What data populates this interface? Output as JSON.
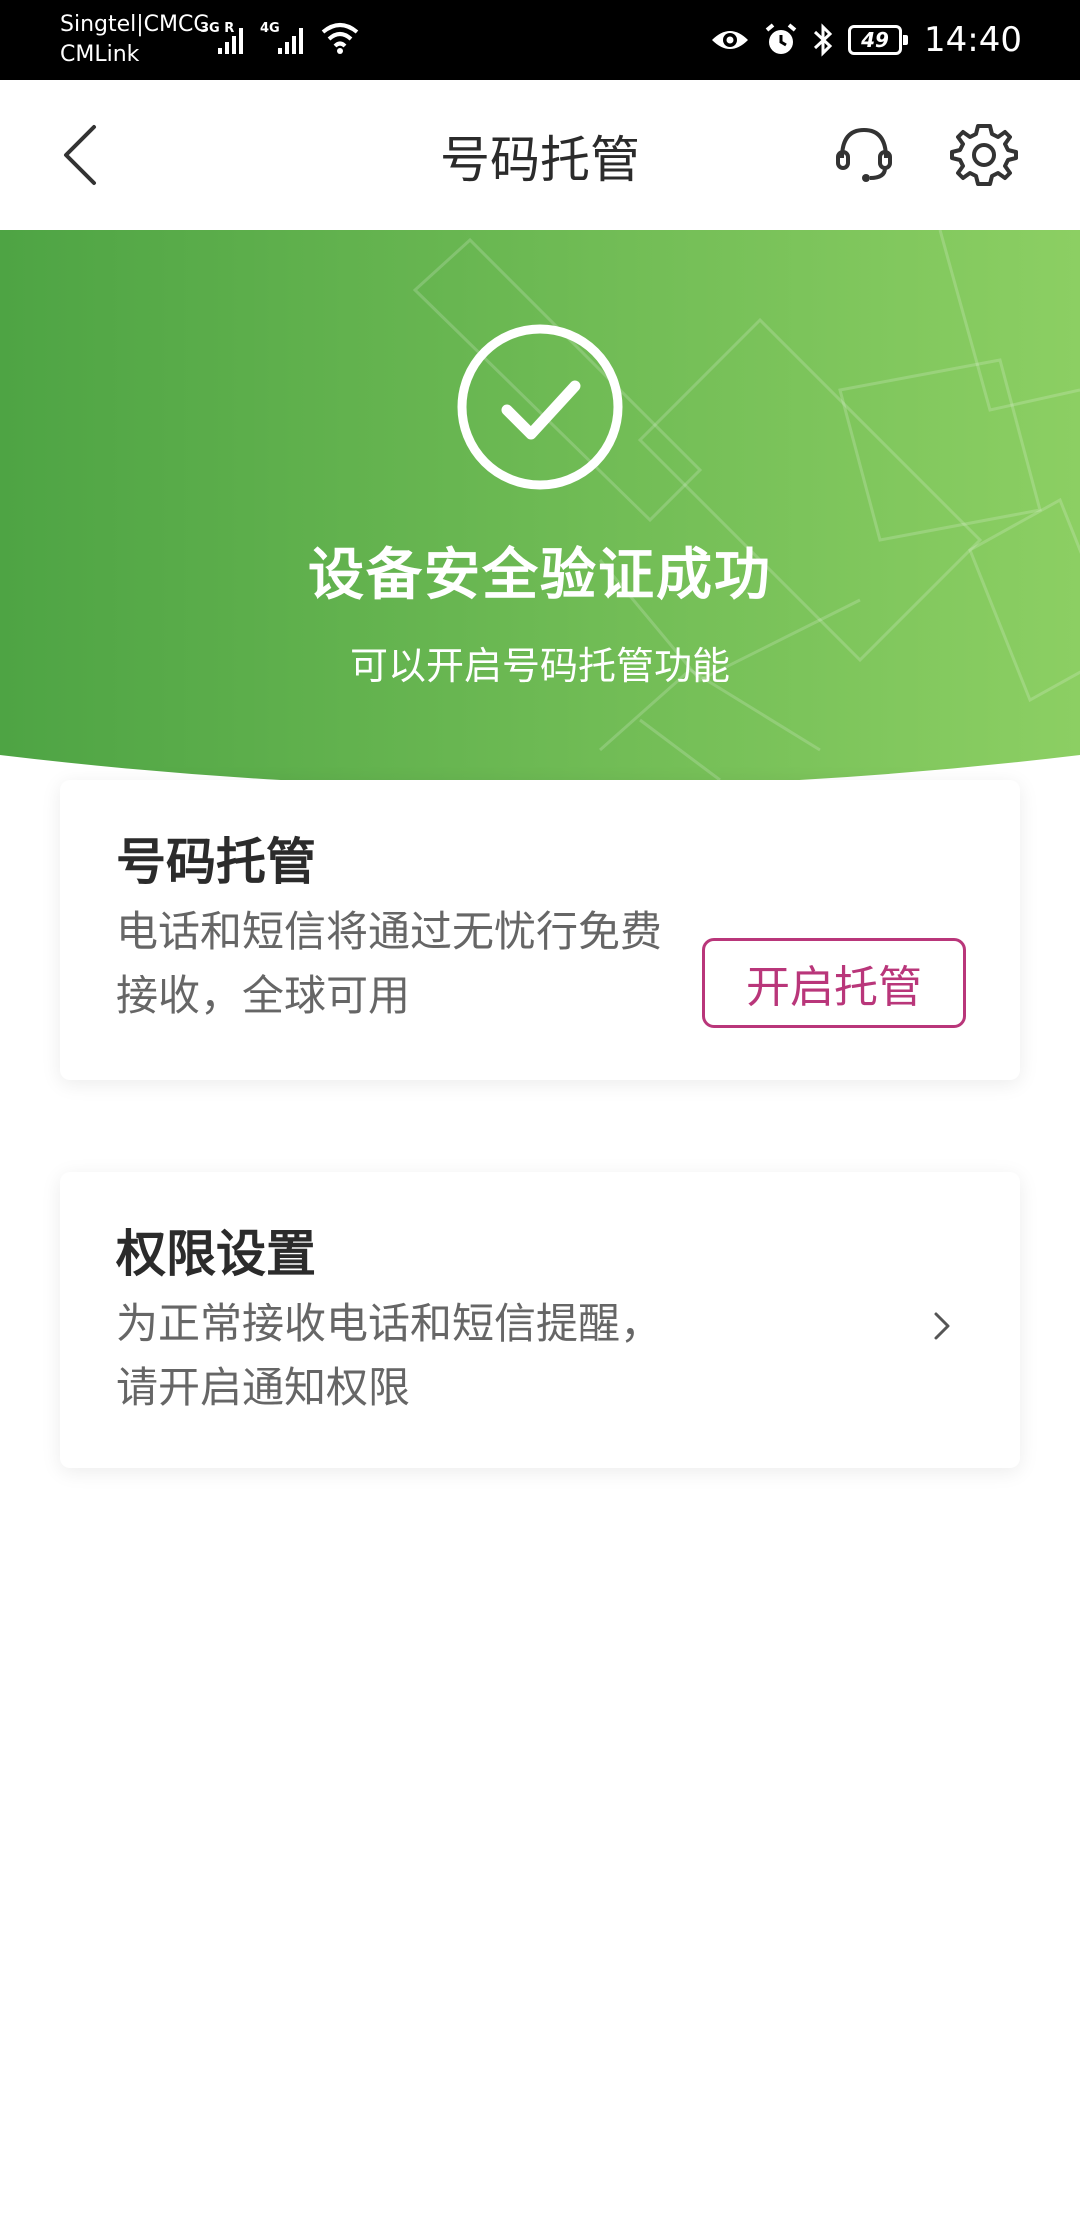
{
  "status_bar": {
    "carrier_line1": "Singtel|CMCC",
    "carrier_line2": "CMLink",
    "network1": "3G R",
    "network2": "4G",
    "battery": "49",
    "time": "14:40"
  },
  "app_bar": {
    "title": "号码托管"
  },
  "hero": {
    "title": "设备安全验证成功",
    "subtitle": "可以开启号码托管功能",
    "colors": {
      "start": "#4ea444",
      "end": "#8ccf63"
    }
  },
  "hosting_card": {
    "title": "号码托管",
    "description": "电话和短信将通过无忧行免费接收，全球可用",
    "button_label": "开启托管",
    "accent": "#b9367a"
  },
  "permission_card": {
    "title": "权限设置",
    "description": "为正常接收电话和短信提醒，请开启通知权限"
  }
}
